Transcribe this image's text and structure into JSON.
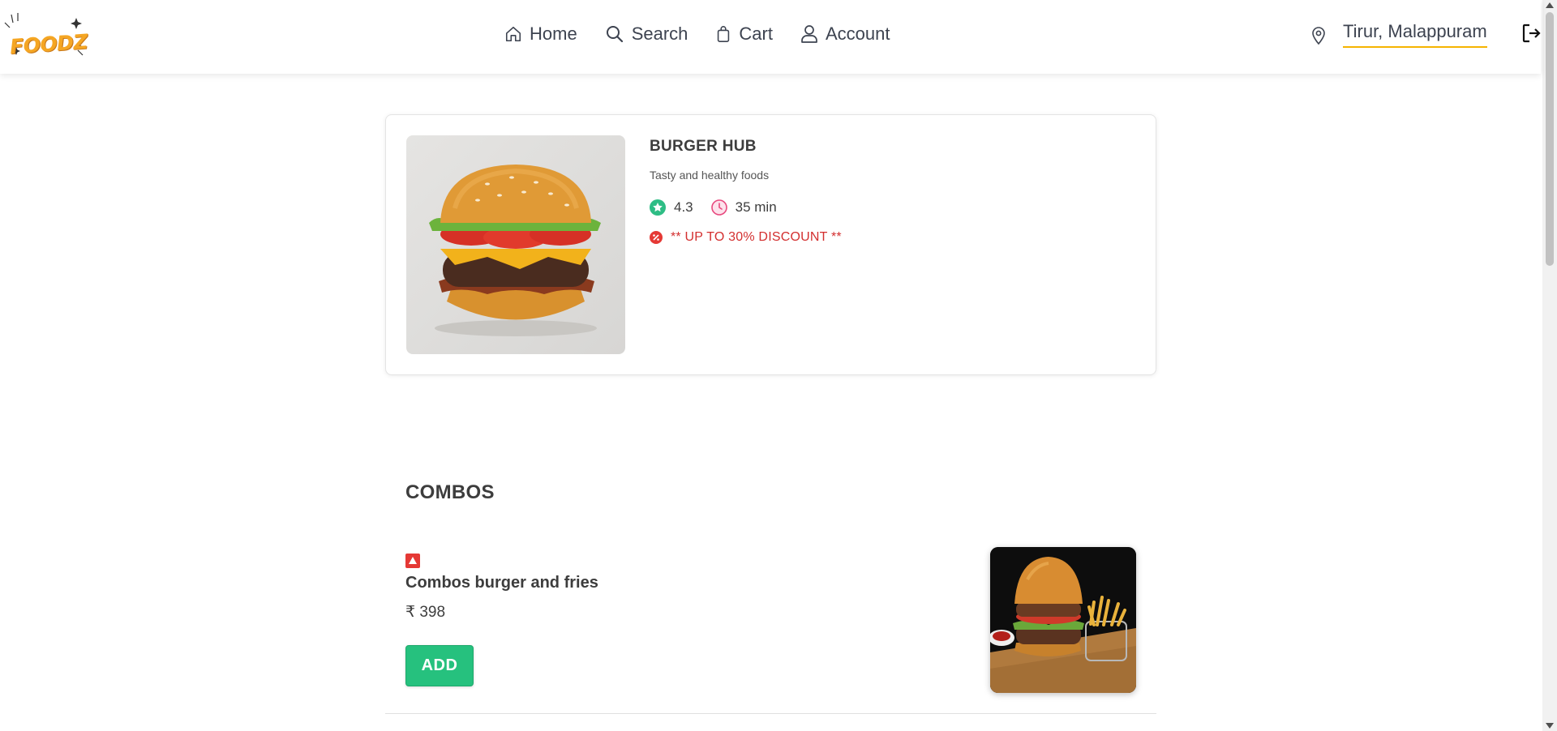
{
  "header": {
    "logo_text": "FOODZ",
    "nav": [
      {
        "label": "Home",
        "icon": "home-icon"
      },
      {
        "label": "Search",
        "icon": "search-icon"
      },
      {
        "label": "Cart",
        "icon": "shopping-bag-icon"
      },
      {
        "label": "Account",
        "icon": "user-icon"
      }
    ],
    "location": "Tirur, Malappuram",
    "location_icon": "map-pin-icon",
    "logout_icon": "logout-icon",
    "accent_color": "#f5b400"
  },
  "restaurant": {
    "name": "BURGER HUB",
    "description": "Tasty and healthy foods",
    "rating": "4.3",
    "rating_icon": "star-badge-icon",
    "rating_color": "#2ebd85",
    "time": "35 min",
    "time_icon": "clock-icon",
    "discount": "** UP TO 30% DISCOUNT **",
    "discount_icon": "discount-badge-icon",
    "discount_color": "#d32f2f",
    "image": "burger-image"
  },
  "menu": {
    "section_title": "COMBOS",
    "items": [
      {
        "badge": "non-veg-badge",
        "name": "Combos burger and fries",
        "price": "₹ 398",
        "add_label": "ADD",
        "image": "burger-and-fries-image"
      }
    ],
    "button_color": "#26c17e"
  }
}
